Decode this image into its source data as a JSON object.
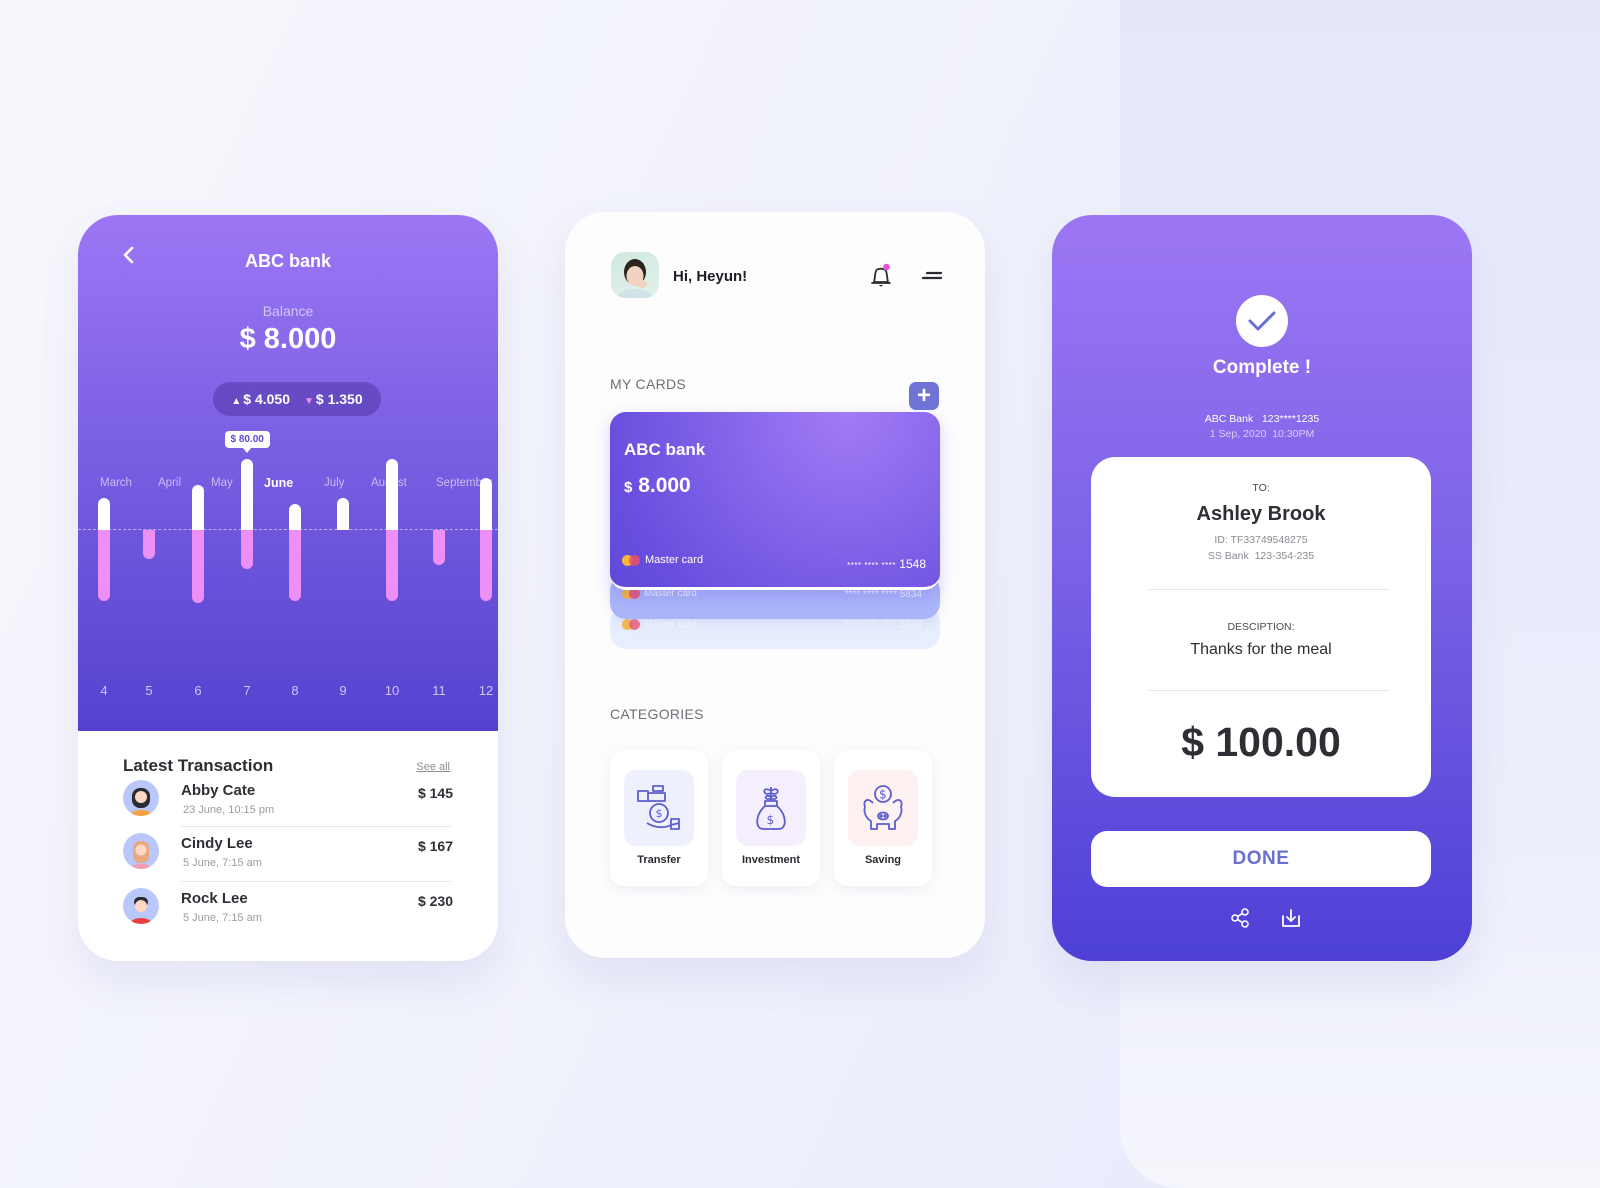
{
  "colors": {
    "primary_gradient_top": "#9c77f5",
    "primary_gradient_bottom": "#4d40d6",
    "accent_pink": "#ee8ff6",
    "button_text": "#6a70d2",
    "notification_dot": "#ee4fd7"
  },
  "screen1": {
    "back_icon": "chevron-left-icon",
    "title": "ABC bank",
    "balance_label": "Balance",
    "balance_value": "$ 8.000",
    "income": "$ 4.050",
    "expense": "$ 1.350",
    "months": [
      "March",
      "April",
      "May",
      "June",
      "July",
      "August",
      "September"
    ],
    "active_month": "June",
    "tooltip": "$ 80.00",
    "latest_title": "Latest Transaction",
    "see_all": "See all",
    "transactions": [
      {
        "name": "Abby Cate",
        "date": "23 June, 10:15 pm",
        "amount": "$ 145"
      },
      {
        "name": "Cindy Lee",
        "date": "5 June, 7:15 am",
        "amount": "$ 167"
      },
      {
        "name": "Rock Lee",
        "date": "5 June, 7:15 am",
        "amount": "$ 230"
      }
    ]
  },
  "chart_data": {
    "type": "bar",
    "title": "",
    "xlabel": "",
    "ylabel": "",
    "categories": [
      "4",
      "5",
      "6",
      "7",
      "8",
      "9",
      "10",
      "11",
      "12"
    ],
    "series": [
      {
        "name": "income",
        "values": [
          22,
          0,
          31,
          49,
          18,
          22,
          49,
          0,
          36
        ]
      },
      {
        "name": "expense",
        "values": [
          49,
          20,
          50,
          27,
          49,
          0,
          49,
          24,
          49
        ]
      }
    ],
    "highlight": {
      "category": "7",
      "label": "$ 80.00"
    },
    "ylim": [
      -55,
      55
    ],
    "grid": false,
    "baseline": "dashed"
  },
  "screen2": {
    "greeting": "Hi, Heyun!",
    "my_cards_label": "MY CARDS",
    "add_label": "+",
    "cards": [
      {
        "bank": "ABC bank",
        "currency": "$",
        "balance": "8.000",
        "type": "Master card",
        "stars": "**** **** ****",
        "last4": "1548"
      },
      {
        "type": "Master card",
        "stars": "**** **** ****",
        "last4": "5834"
      },
      {
        "type": "Master card",
        "stars": "**** **** ****",
        "last4": "5834"
      }
    ],
    "categories_label": "CATEGORIES",
    "categories": [
      {
        "label": "Transfer",
        "icon": "money-transfer-icon",
        "bg": "#eef0fd"
      },
      {
        "label": "Investment",
        "icon": "investment-bag-icon",
        "bg": "#f5effd"
      },
      {
        "label": "Saving",
        "icon": "piggy-bank-icon",
        "bg": "#fdf1f1"
      }
    ]
  },
  "screen3": {
    "status": "Complete !",
    "from_line": "ABC Bank   123****1235",
    "datetime": "1 Sep, 2020  10:30PM",
    "to_label": "TO:",
    "recipient": "Ashley Brook",
    "recipient_id": "ID: TF33749548275",
    "recipient_bank": "SS Bank  123-354-235",
    "description_label": "DESCIPTION:",
    "description": "Thanks for the meal",
    "amount": "$ 100.00",
    "done_label": "DONE"
  }
}
